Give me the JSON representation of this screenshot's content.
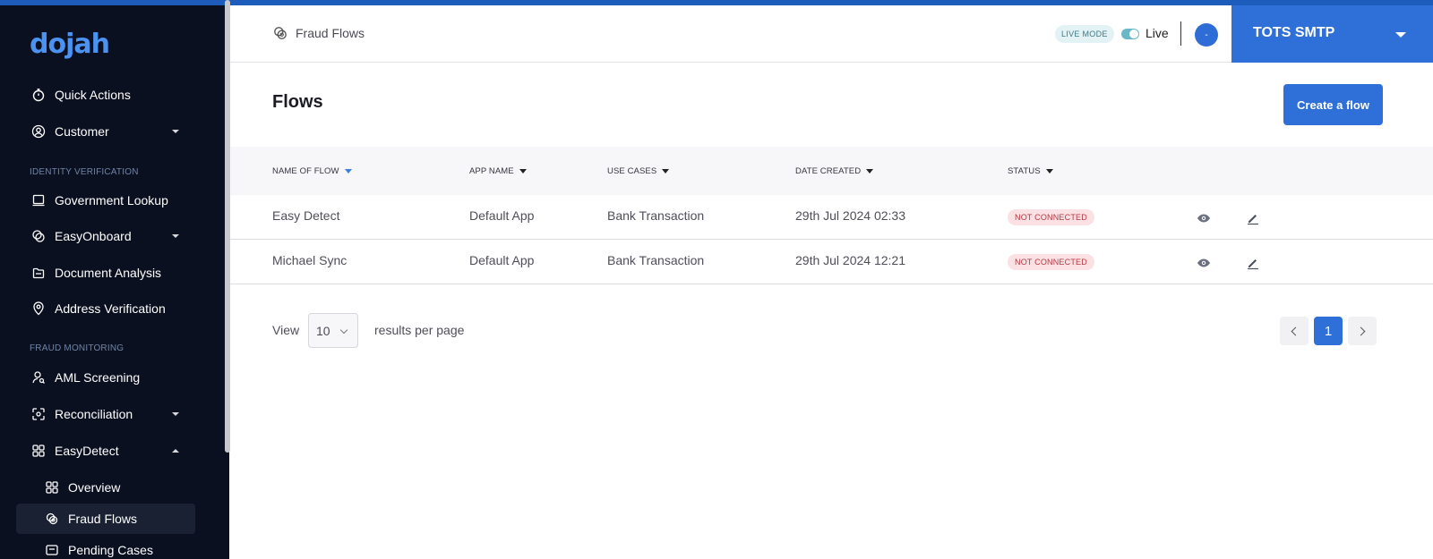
{
  "brand": {
    "logo_text": "dojah",
    "accent": "#2f6fd8"
  },
  "sidebar": {
    "items": [
      {
        "label": "Quick Actions",
        "icon": "stopwatch-icon"
      },
      {
        "label": "Customer",
        "icon": "user-circle-icon",
        "expandable": true
      },
      {
        "label": "Government Lookup",
        "icon": "id-card-icon"
      },
      {
        "label": "EasyOnboard",
        "icon": "link-icon",
        "expandable": true
      },
      {
        "label": "Document Analysis",
        "icon": "document-icon"
      },
      {
        "label": "Address Verification",
        "icon": "location-pin-icon"
      },
      {
        "label": "AML Screening",
        "icon": "person-search-icon"
      },
      {
        "label": "Reconciliation",
        "icon": "reconcile-icon",
        "expandable": true
      },
      {
        "label": "EasyDetect",
        "icon": "grid-icon",
        "expanded": true
      },
      {
        "label": "Overview",
        "icon": "grid-icon"
      },
      {
        "label": "Fraud Flows",
        "icon": "fraud-flows-icon",
        "active": true
      },
      {
        "label": "Pending Cases",
        "icon": "cases-icon"
      }
    ],
    "sections": {
      "identity": "IDENTITY VERIFICATION",
      "fraud": "FRAUD MONITORING"
    }
  },
  "header": {
    "breadcrumb": "Fraud Flows",
    "live_mode_badge": "LIVE MODE",
    "live_toggle_on": true,
    "live_label": "Live",
    "avatar_text": "-",
    "org_name": "TOTS SMTP"
  },
  "main": {
    "title": "Flows",
    "create_button": "Create a flow",
    "columns": [
      "NAME OF FLOW",
      "APP NAME",
      "USE CASES",
      "DATE CREATED",
      "STATUS"
    ],
    "rows": [
      {
        "name": "Easy Detect",
        "app": "Default App",
        "use_case": "Bank Transaction",
        "date": "29th Jul 2024 02:33",
        "status": "NOT CONNECTED"
      },
      {
        "name": "Michael Sync",
        "app": "Default App",
        "use_case": "Bank Transaction",
        "date": "29th Jul 2024 12:21",
        "status": "NOT CONNECTED"
      }
    ]
  },
  "pagination": {
    "view_label": "View",
    "per_page": "10",
    "results_label": "results per page",
    "current_page": "1"
  }
}
